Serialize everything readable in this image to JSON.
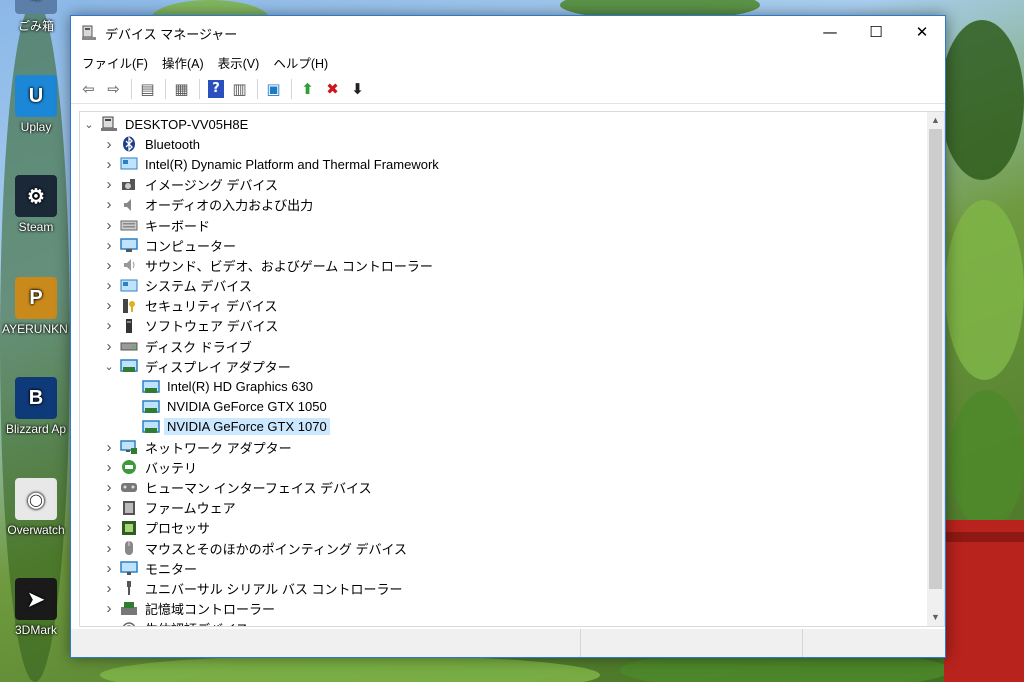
{
  "desktop": {
    "icons": [
      {
        "label": "ごみ箱",
        "color": "#5b7fa8",
        "glyph": "♲"
      },
      {
        "label": "Uplay",
        "color": "#1b87d6",
        "glyph": "U"
      },
      {
        "label": "Steam",
        "color": "#1b2838",
        "glyph": "⚙"
      },
      {
        "label": "AYERUNKN TTLEGROUN",
        "color": "#c98a1b",
        "glyph": "P"
      },
      {
        "label": "Blizzard Ap",
        "color": "#0f3a7a",
        "glyph": "B"
      },
      {
        "label": "Overwatch",
        "color": "#e8e8e8",
        "glyph": "◉"
      },
      {
        "label": "3DMark",
        "color": "#1a1a1a",
        "glyph": "➤"
      }
    ]
  },
  "window": {
    "title": "デバイス マネージャー",
    "controls": {
      "minimize": "—",
      "maximize": "☐",
      "close": "✕"
    },
    "menu": [
      "ファイル(F)",
      "操作(A)",
      "表示(V)",
      "ヘルプ(H)"
    ],
    "toolbar": [
      {
        "name": "back-icon",
        "glyph": "⇦",
        "color": "#7a7a7a"
      },
      {
        "name": "forward-icon",
        "glyph": "⇨",
        "color": "#7a7a7a"
      },
      {
        "sep": true
      },
      {
        "name": "properties-icon",
        "glyph": "▤",
        "color": "#555555"
      },
      {
        "sep": true
      },
      {
        "name": "list-view-icon",
        "glyph": "▦",
        "color": "#555555"
      },
      {
        "sep": true
      },
      {
        "name": "help-icon",
        "glyph": "?",
        "color": "#ffffff",
        "bg": "#2b4fbf"
      },
      {
        "name": "driver-details-icon",
        "glyph": "▥",
        "color": "#555555"
      },
      {
        "sep": true
      },
      {
        "name": "scan-hardware-icon",
        "glyph": "▣",
        "color": "#1f7ac6"
      },
      {
        "sep": true
      },
      {
        "name": "update-driver-icon",
        "glyph": "⬆",
        "color": "#2e9e3a"
      },
      {
        "name": "uninstall-icon",
        "glyph": "✖",
        "color": "#d0141d"
      },
      {
        "name": "disable-icon",
        "glyph": "⬇",
        "color": "#222222"
      }
    ]
  },
  "tree": {
    "root": "DESKTOP-VV05H8E",
    "items": [
      {
        "label": "Bluetooth",
        "icon": "bluetooth-icon",
        "expanded": false
      },
      {
        "label": "Intel(R) Dynamic Platform and Thermal Framework",
        "icon": "system-device-icon",
        "expanded": false
      },
      {
        "label": "イメージング デバイス",
        "icon": "camera-icon",
        "expanded": false
      },
      {
        "label": "オーディオの入力および出力",
        "icon": "speaker-icon",
        "expanded": false
      },
      {
        "label": "キーボード",
        "icon": "keyboard-icon",
        "expanded": false
      },
      {
        "label": "コンピューター",
        "icon": "computer-icon",
        "expanded": false
      },
      {
        "label": "サウンド、ビデオ、およびゲーム コントローラー",
        "icon": "sound-icon",
        "expanded": false
      },
      {
        "label": "システム デバイス",
        "icon": "system-device-icon",
        "expanded": false
      },
      {
        "label": "セキュリティ デバイス",
        "icon": "security-key-icon",
        "expanded": false
      },
      {
        "label": "ソフトウェア デバイス",
        "icon": "software-device-icon",
        "expanded": false
      },
      {
        "label": "ディスク ドライブ",
        "icon": "disk-drive-icon",
        "expanded": false
      },
      {
        "label": "ディスプレイ アダプター",
        "icon": "display-adapter-icon",
        "expanded": true,
        "children": [
          {
            "label": "Intel(R) HD Graphics 630",
            "selected": false
          },
          {
            "label": "NVIDIA GeForce GTX 1050",
            "selected": false
          },
          {
            "label": "NVIDIA GeForce GTX 1070",
            "selected": true
          }
        ]
      },
      {
        "label": "ネットワーク アダプター",
        "icon": "network-icon",
        "expanded": false
      },
      {
        "label": "バッテリ",
        "icon": "battery-icon",
        "expanded": false
      },
      {
        "label": "ヒューマン インターフェイス デバイス",
        "icon": "hid-icon",
        "expanded": false
      },
      {
        "label": "ファームウェア",
        "icon": "firmware-icon",
        "expanded": false
      },
      {
        "label": "プロセッサ",
        "icon": "processor-icon",
        "expanded": false
      },
      {
        "label": "マウスとそのほかのポインティング デバイス",
        "icon": "mouse-icon",
        "expanded": false
      },
      {
        "label": "モニター",
        "icon": "monitor-icon",
        "expanded": false
      },
      {
        "label": "ユニバーサル シリアル バス コントローラー",
        "icon": "usb-icon",
        "expanded": false
      },
      {
        "label": "記憶域コントローラー",
        "icon": "storage-controller-icon",
        "expanded": false
      },
      {
        "label": "生体認証デバイス",
        "icon": "biometric-icon",
        "expanded": false
      }
    ]
  },
  "colors": {
    "accent": "#2b79d1",
    "selection": "#cce8ff"
  }
}
